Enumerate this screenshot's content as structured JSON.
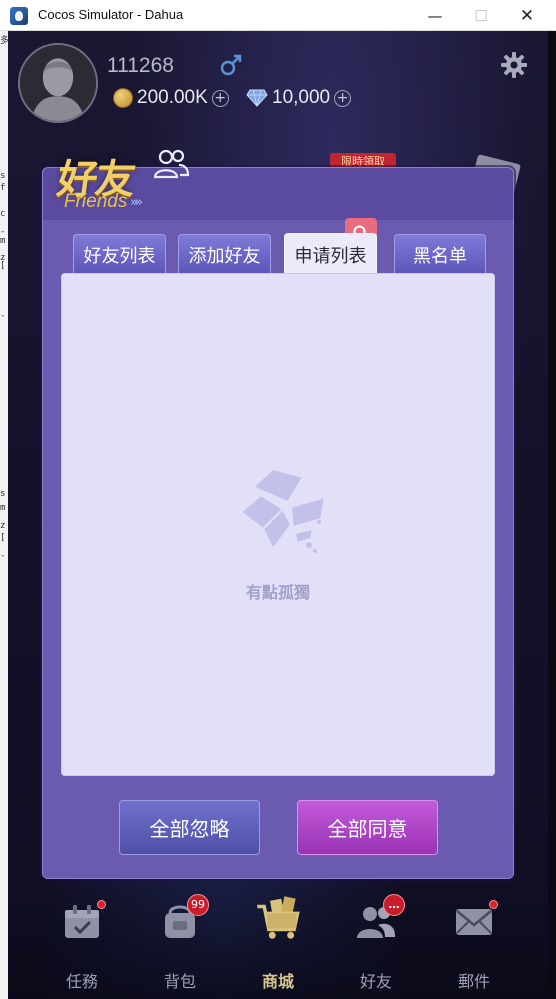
{
  "window": {
    "title": "Cocos Simulator - Dahua",
    "minimize": "—",
    "maximize": "☐",
    "close": "✕"
  },
  "console": {
    "lines": [
      "多",
      "s",
      "f",
      "c",
      "-",
      "m",
      "z",
      "[",
      "-",
      "s",
      "m",
      "z",
      "[",
      "-"
    ]
  },
  "player": {
    "id": "111268",
    "gold": "200.00K",
    "gems": "10,000"
  },
  "promo": {
    "label": "限時領取"
  },
  "panel": {
    "title_cn": "好友",
    "title_en": "Friends",
    "title_arrows": "»»",
    "tabs": [
      {
        "label": "好友列表",
        "active": false
      },
      {
        "label": "添加好友",
        "active": false
      },
      {
        "label": "申请列表",
        "active": true
      },
      {
        "label": "黑名单",
        "active": false
      }
    ],
    "empty_text": "有點孤獨",
    "ignore_all": "全部忽略",
    "agree_all": "全部同意"
  },
  "nav": {
    "items": [
      {
        "label": "任務",
        "icon": "task-calendar-icon",
        "badge": "dot"
      },
      {
        "label": "背包",
        "icon": "backpack-icon",
        "badge": "99"
      },
      {
        "label": "商城",
        "icon": "shop-cart-icon",
        "badge": ""
      },
      {
        "label": "好友",
        "icon": "friends-icon",
        "badge": "…"
      },
      {
        "label": "郵件",
        "icon": "mail-icon",
        "badge": "dot"
      }
    ]
  },
  "colors": {
    "accent_gold": "#f1d06a",
    "panel": "#6a5ab0",
    "agree": "#b14ac9",
    "ignore": "#5f60b9",
    "badge": "#c81e2c"
  }
}
